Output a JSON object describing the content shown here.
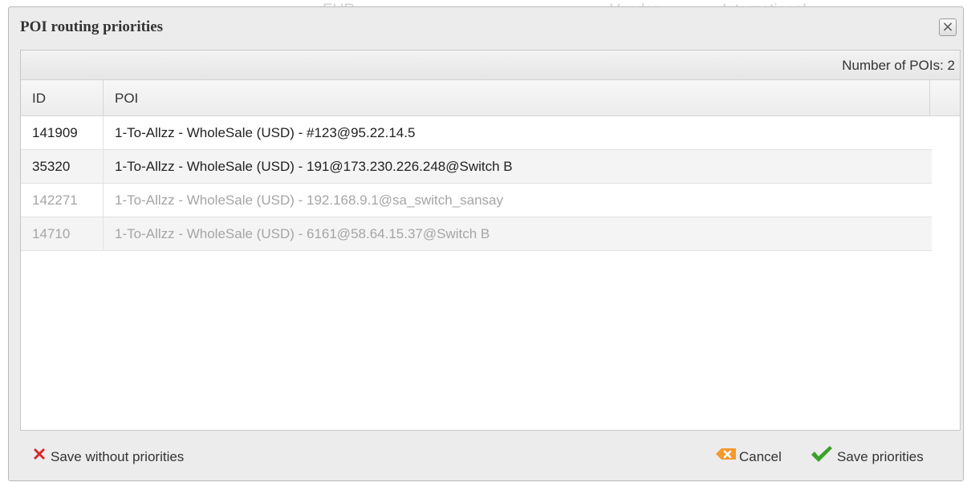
{
  "background": {
    "items": [
      "EUR",
      "Vendor",
      "International"
    ]
  },
  "dialog": {
    "title": "POI routing priorities",
    "close_symbol": "×",
    "count_text": "Number of POIs: 2",
    "columns": {
      "id": "ID",
      "poi": "POI"
    },
    "rows": [
      {
        "id": "141909",
        "poi": "1-To-Allzz - WholeSale (USD) - #123@95.22.14.5",
        "state": "active"
      },
      {
        "id": "35320",
        "poi": "1-To-Allzz - WholeSale (USD) - 191@173.230.226.248@Switch B",
        "state": "active"
      },
      {
        "id": "142271",
        "poi": "1-To-Allzz - WholeSale (USD) - 192.168.9.1@sa_switch_sansay",
        "state": "disabled"
      },
      {
        "id": "14710",
        "poi": "1-To-Allzz - WholeSale (USD) - 6161@58.64.15.37@Switch B",
        "state": "disabled"
      }
    ],
    "footer": {
      "save_without_label": "Save without priorities",
      "cancel_label": "Cancel",
      "save_label": "Save priorities"
    }
  },
  "colors": {
    "accent_green": "#3aa22a",
    "accent_red": "#d7262e",
    "accent_orange": "#f39a2d"
  },
  "icons": {
    "save_without": "red-x-icon",
    "cancel": "orange-cancel-icon",
    "save": "green-check-icon"
  }
}
